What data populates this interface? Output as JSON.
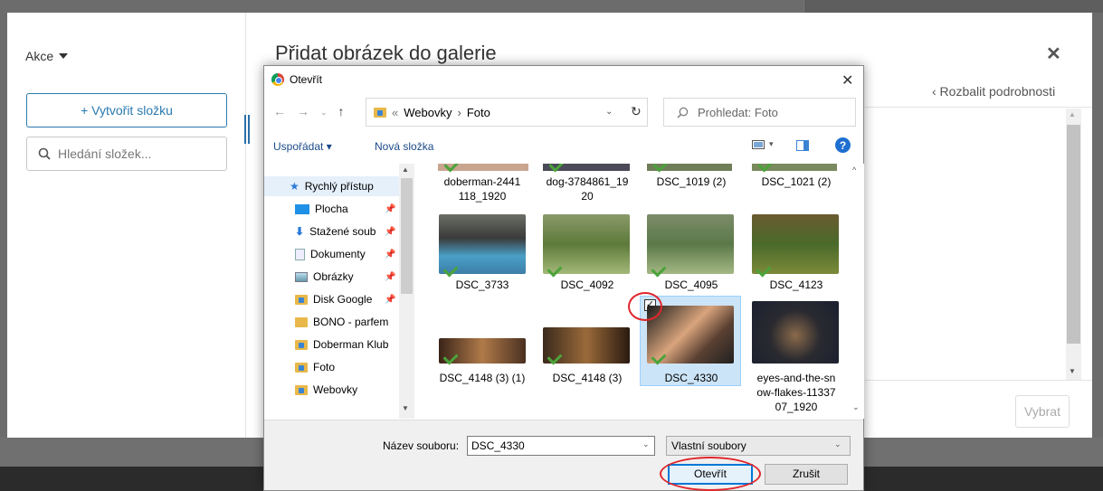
{
  "page": {
    "sidebar": {
      "actions_label": "Akce",
      "create_folder_label": "+ Vytvořit složku",
      "folder_search_placeholder": "Hledání složek..."
    },
    "modal": {
      "title": "Přidat obrázek do galerie",
      "close_glyph": "✕",
      "expand_details_label": "‹ Rozbalit podrobnosti",
      "select_button_label": "Vybrat"
    }
  },
  "dialog": {
    "title": "Otevřít",
    "close_glyph": "✕",
    "breadcrumb": {
      "prefix": "«",
      "items": [
        "Webovky",
        "Foto"
      ],
      "separator": "›"
    },
    "search_placeholder": "Prohledat: Foto",
    "toolbar": {
      "organize_label": "Uspořádat ▾",
      "new_folder_label": "Nová složka",
      "help_glyph": "?"
    },
    "nav_items": [
      {
        "label": "Rychlý přístup",
        "icon": "star-icon",
        "pinned": false
      },
      {
        "label": "Plocha",
        "icon": "desktop-icon",
        "pinned": true
      },
      {
        "label": "Stažené soub",
        "icon": "download-icon",
        "pinned": true
      },
      {
        "label": "Dokumenty",
        "icon": "document-icon",
        "pinned": true
      },
      {
        "label": "Obrázky",
        "icon": "pictures-icon",
        "pinned": true
      },
      {
        "label": "Disk Google",
        "icon": "folder-icon",
        "pinned": true
      },
      {
        "label": "BONO - parfem",
        "icon": "folder-icon",
        "pinned": false
      },
      {
        "label": "Doberman Klub",
        "icon": "folder-icon",
        "pinned": false
      },
      {
        "label": "Foto",
        "icon": "folder-icon",
        "pinned": false
      },
      {
        "label": "Webovky",
        "icon": "folder-icon",
        "pinned": false
      }
    ],
    "files": [
      {
        "name": "doberman-2441\n118_1920"
      },
      {
        "name": "dog-3784861_19\n20"
      },
      {
        "name": "DSC_1019 (2)"
      },
      {
        "name": "DSC_1021 (2)"
      },
      {
        "name": "DSC_3733"
      },
      {
        "name": "DSC_4092"
      },
      {
        "name": "DSC_4095"
      },
      {
        "name": "DSC_4123"
      },
      {
        "name": "DSC_4148 (3) (1)"
      },
      {
        "name": "DSC_4148 (3)"
      },
      {
        "name": "DSC_4330"
      },
      {
        "name": "eyes-and-the-sn\now-flakes-11337\n07_1920"
      }
    ],
    "selected_file": "DSC_4330",
    "filename_label": "Název souboru:",
    "filename_value": "DSC_4330",
    "filetype_value": "Vlastní soubory",
    "open_button_label": "Otevřít",
    "cancel_button_label": "Zrušit",
    "colors": {
      "accent": "#0078d7",
      "annotation": "#e0262c",
      "check": "#4ba33a"
    }
  }
}
